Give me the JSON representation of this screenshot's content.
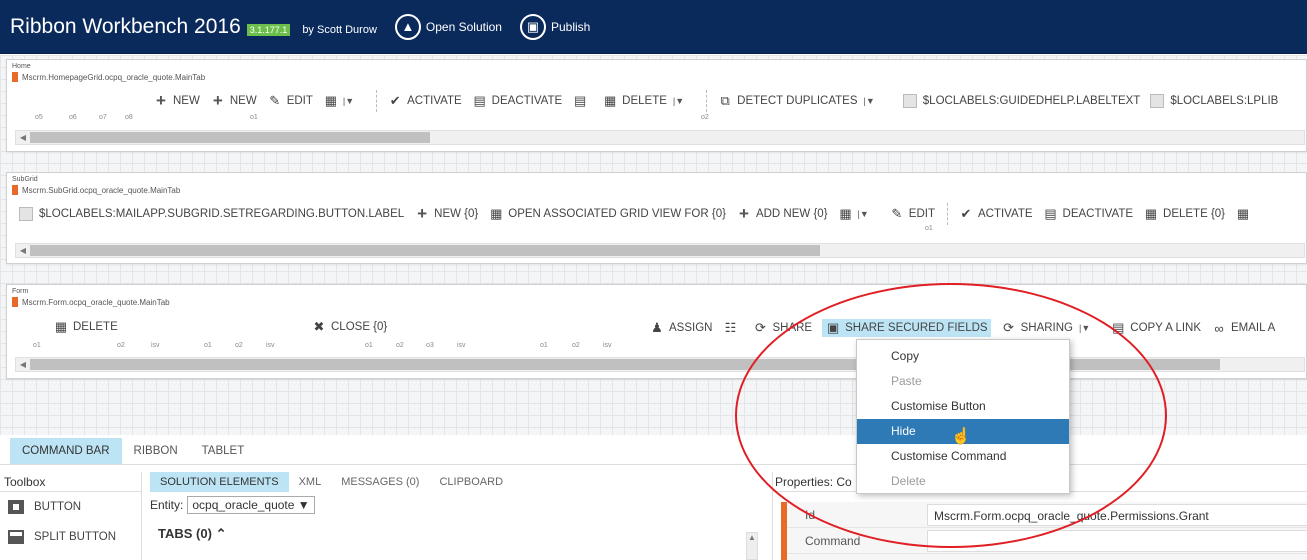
{
  "app": {
    "title": "Ribbon Workbench 2016",
    "version": "3.1.177.1",
    "byline": "by Scott Durow",
    "open_solution": "Open Solution",
    "publish": "Publish"
  },
  "home": {
    "title": "Home",
    "tab": "Mscrm.HomepageGrid.ocpq_oracle_quote.MainTab",
    "groups": [
      "o5",
      "o6",
      "o7",
      "o8",
      "o1",
      "o2"
    ],
    "buttons": {
      "new1": "NEW",
      "new2": "NEW",
      "edit": "EDIT",
      "activate": "ACTIVATE",
      "deactivate": "DEACTIVATE",
      "delete": "DELETE",
      "detect": "DETECT DUPLICATES",
      "guided": "$LOCLABELS:GUIDEDHELP.LABELTEXT",
      "lplib": "$LOCLABELS:LPLIB"
    }
  },
  "subgrid": {
    "title": "SubGrid",
    "tab": "Mscrm.SubGrid.ocpq_oracle_quote.MainTab",
    "groups": [
      "o1"
    ],
    "buttons": {
      "mailapp": "$LOCLABELS:MAILAPP.SUBGRID.SETREGARDING.BUTTON.LABEL",
      "new": "NEW {0}",
      "open_assoc": "OPEN ASSOCIATED GRID VIEW FOR {0}",
      "add_new": "ADD NEW {0}",
      "edit": "EDIT",
      "activate": "ACTIVATE",
      "deactivate": "DEACTIVATE",
      "delete": "DELETE {0}"
    }
  },
  "form": {
    "title": "Form",
    "tab": "Mscrm.Form.ocpq_oracle_quote.MainTab",
    "groups": [
      "o1",
      "o2",
      "isv",
      "o1",
      "o2",
      "isv",
      "o1",
      "o2",
      "o3",
      "isv",
      "o1",
      "o2",
      "isv"
    ],
    "buttons": {
      "delete": "DELETE",
      "close": "CLOSE {0}",
      "assign": "ASSIGN",
      "share": "SHARE",
      "share_secured": "SHARE SECURED FIELDS",
      "sharing": "SHARING",
      "copy_link": "COPY A LINK",
      "email": "EMAIL A"
    }
  },
  "context_menu": {
    "items": [
      {
        "label": "Copy",
        "state": "normal"
      },
      {
        "label": "Paste",
        "state": "disabled"
      },
      {
        "label": "Customise Button",
        "state": "normal"
      },
      {
        "label": "Hide",
        "state": "selected"
      },
      {
        "label": "Customise Command",
        "state": "normal"
      },
      {
        "label": "Delete",
        "state": "disabled"
      }
    ]
  },
  "bottom": {
    "tabs": [
      "COMMAND BAR",
      "RIBBON",
      "TABLET"
    ],
    "toolbox": {
      "title": "Toolbox",
      "items": [
        "BUTTON",
        "SPLIT BUTTON"
      ]
    },
    "solution": {
      "tabs": [
        "SOLUTION ELEMENTS",
        "XML",
        "MESSAGES (0)",
        "CLIPBOARD"
      ],
      "entity_label": "Entity:",
      "entity_value": "ocpq_oracle_quote",
      "tabs_heading": "TABS (0)"
    },
    "properties": {
      "title": "Properties: Co",
      "rows": [
        {
          "key": "Id",
          "value": "Mscrm.Form.ocpq_oracle_quote.Permissions.Grant"
        },
        {
          "key": "Command",
          "value": ""
        }
      ]
    }
  },
  "colors": {
    "topbar": "#0b2a5c",
    "accent": "#e86a2b",
    "highlight": "#bde4f5",
    "selected": "#2e7ab6",
    "annotation": "#e01e24"
  }
}
